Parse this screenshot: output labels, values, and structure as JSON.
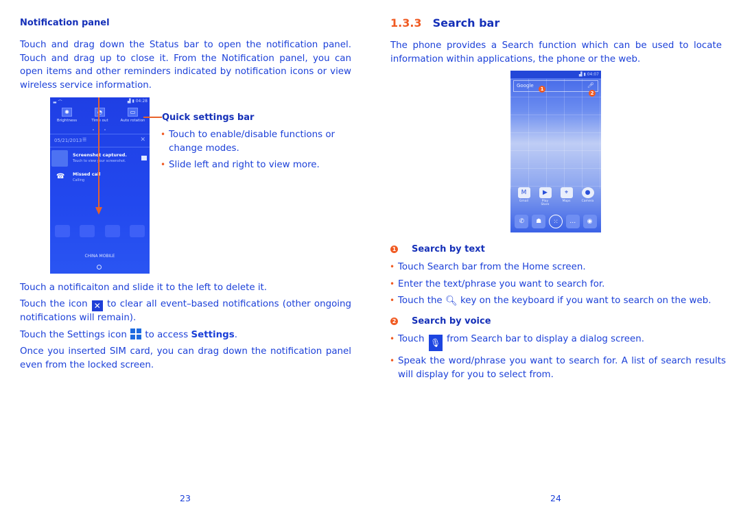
{
  "left_page": {
    "section_title": "Notification panel",
    "intro": "Touch and drag down the Status bar to open the notification panel. Touch and drag up to close it. From the Notification panel, you can open items and other reminders indicated by notification icons or view wireless service information.",
    "phone_screenshot": {
      "status_time": "04:28",
      "quick_settings": [
        {
          "label": "Brightness",
          "icon": "brightness-icon"
        },
        {
          "label": "Time out",
          "icon": "timeout-icon"
        },
        {
          "label": "Auto rotation",
          "icon": "auto-rotation-icon"
        }
      ],
      "date": "05/21/2013",
      "notifications": [
        {
          "title": "Screenshot captured.",
          "subtitle": "Touch to view your screenshot.",
          "icon": "avatar-icon"
        },
        {
          "title": "Missed call",
          "subtitle": "Calling",
          "icon": "missed-call-icon"
        }
      ],
      "carrier": "CHINA MOBILE"
    },
    "quick_settings_callout": {
      "title": "Quick settings bar",
      "bullets": [
        "Touch to enable/disable functions or change modes.",
        "Slide left and right to view more."
      ]
    },
    "paragraphs": {
      "delete": "Touch a notificaiton and slide it to the left to delete it.",
      "clear_before": "Touch the icon",
      "clear_after": "to clear all event–based notifications (other ongoing notifications will remain).",
      "settings_before": "Touch the Settings icon",
      "settings_middle": "to access",
      "settings_bold": "Settings",
      "settings_end": ".",
      "sim": "Once you inserted SIM card, you can drag down the notification panel even from the locked screen."
    },
    "page_number": "23"
  },
  "right_page": {
    "section_number": "1.3.3",
    "section_title": "Search bar",
    "intro": "The phone provides a Search function which can be used to locate information within applications, the phone or the web.",
    "phone_screenshot": {
      "status_time": "04:07",
      "search_label": "Google",
      "badges": [
        "1",
        "2"
      ],
      "apps": [
        "Gmail",
        "Play Store",
        "Maps",
        "Camera"
      ]
    },
    "search_by_text": {
      "marker": "1",
      "title": "Search by text",
      "bullets": [
        "Touch Search bar from the Home screen.",
        "Enter the text/phrase you want to search for."
      ],
      "key_before": "Touch the",
      "key_after": "key on the keyboard if you want to search on the web."
    },
    "search_by_voice": {
      "marker": "2",
      "title": "Search by voice",
      "touch_before": "Touch",
      "touch_after": "from Search bar to display a dialog screen.",
      "speak": "Speak the word/phrase you want to search for.  A list of search results will display for you to select from."
    },
    "page_number": "24"
  }
}
